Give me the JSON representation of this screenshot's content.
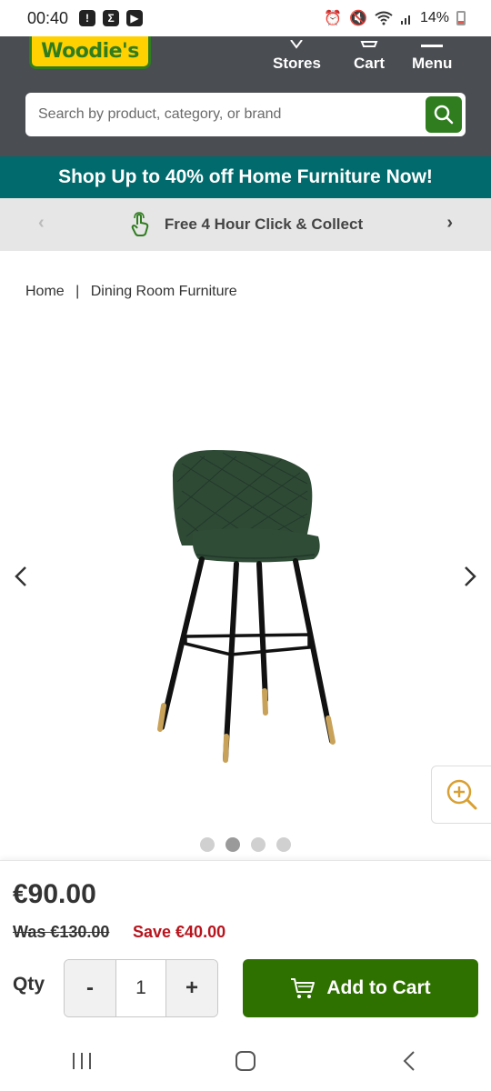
{
  "status_bar": {
    "time": "00:40",
    "battery": "14%"
  },
  "header": {
    "logo_text": "Woodie's",
    "nav": [
      {
        "label": "Stores",
        "icon": "location-icon"
      },
      {
        "label": "Cart",
        "icon": "cart-icon"
      },
      {
        "label": "Menu",
        "icon": "menu-icon"
      }
    ],
    "search": {
      "placeholder": "Search by product, category, or brand",
      "value": ""
    }
  },
  "promo_banner": {
    "text": "Shop Up to 40% off Home Furniture Now!",
    "color": "#006a6c"
  },
  "usp_bar": {
    "text": "Free 4 Hour Click & Collect"
  },
  "breadcrumb": {
    "items": [
      "Home",
      "Dining Room Furniture"
    ],
    "separator": "|"
  },
  "gallery": {
    "image_count": 4,
    "active_index": 1
  },
  "pricing": {
    "price": "€90.00",
    "was": "Was €130.00",
    "save": "Save €40.00"
  },
  "purchase": {
    "qty_label": "Qty",
    "minus": "-",
    "plus": "+",
    "quantity": "1",
    "add_to_cart": "Add to Cart",
    "brand_green": "#2f7100"
  }
}
